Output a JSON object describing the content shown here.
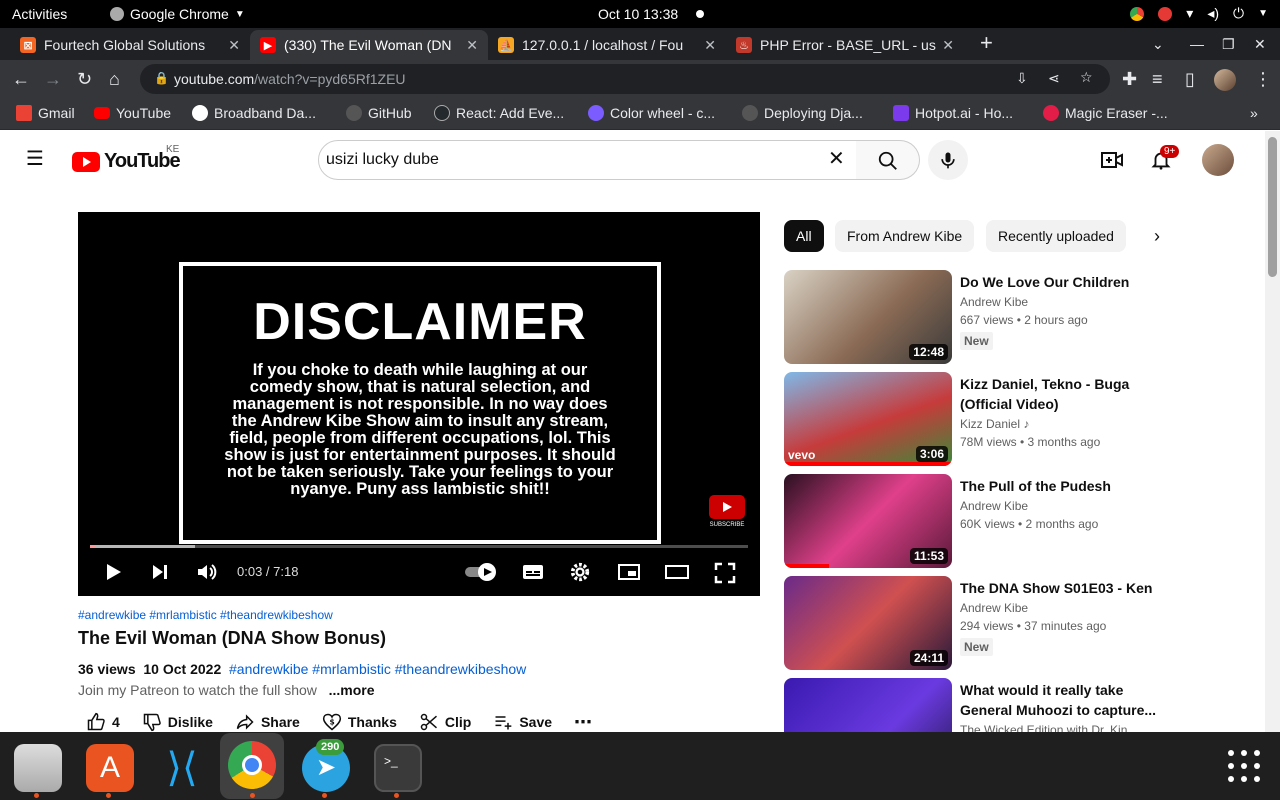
{
  "system": {
    "activities": "Activities",
    "app_name": "Google Chrome",
    "clock": "Oct 10  13:38"
  },
  "tabs": [
    {
      "title": "Fourtech Global Solutions",
      "fav_color": "#f26522"
    },
    {
      "title": "(330) The Evil Woman (DN",
      "fav_color": "#ff0000"
    },
    {
      "title": "127.0.0.1 / localhost / Fou",
      "fav_color": "#f5a623"
    },
    {
      "title": "PHP Error - BASE_URL - us",
      "fav_color": "#c0392b"
    }
  ],
  "omnibox": {
    "host": "youtube.com",
    "path": "/watch?v=pyd65Rf1ZEU"
  },
  "bookmarks": [
    {
      "label": "Gmail",
      "color": "#ea4335"
    },
    {
      "label": "YouTube",
      "color": "#ff0000"
    },
    {
      "label": "Broadband Da...",
      "color": "#ffffff"
    },
    {
      "label": "GitHub",
      "color": "#555555"
    },
    {
      "label": "React: Add Eve...",
      "color": "#24292e"
    },
    {
      "label": "Color wheel - c...",
      "color": "#7b5cff"
    },
    {
      "label": "Deploying Dja...",
      "color": "#555555"
    },
    {
      "label": "Hotpot.ai - Ho...",
      "color": "#7c3aed"
    },
    {
      "label": "Magic Eraser -...",
      "color": "#e11d48"
    }
  ],
  "youtube": {
    "logo_text": "YouTube",
    "country": "KE",
    "search_value": "usizi lucky dube",
    "notif_count": "9+"
  },
  "player": {
    "heading": "DISCLAIMER",
    "body": "If you choke to death while laughing at our comedy show, that is natural selection, and management is not responsible. In no way does the Andrew Kibe Show aim to insult any stream,  field, people from different occupations, lol. This show is just for entertainment purposes. It should not be taken seriously. Take your feelings to your nyanye. Puny ass lambistic shit!!",
    "subscribe": "SUBSCRIBE",
    "time": "0:03 / 7:18",
    "progress": 0.007,
    "buffered": 0.16
  },
  "video": {
    "tags": "#andrewkibe #mrlambistic #theandrewkibeshow",
    "title": "The Evil Woman (DNA Show Bonus)",
    "views": "36 views",
    "date": "10 Oct 2022",
    "meta_tags": "#andrewkibe #mrlambistic #theandrewkibeshow",
    "description": "Join my Patreon to watch the full show",
    "more": "...more",
    "likes": "4",
    "actions": [
      "Dislike",
      "Share",
      "Thanks",
      "Clip",
      "Save"
    ]
  },
  "chips": [
    "All",
    "From Andrew Kibe",
    "Recently uploaded"
  ],
  "recommendations": [
    {
      "title": "Do We Love Our Children",
      "channel": "Andrew Kibe",
      "views": "667 views • 2 hours ago",
      "badge": "New",
      "duration": "12:48",
      "watched": 0,
      "thumb": "linear-gradient(135deg,#d9d2c5,#8b6b55 55%,#3a3a3a)"
    },
    {
      "title": "Kizz Daniel, Tekno - Buga (Official Video)",
      "channel": "Kizz Daniel",
      "views": "78M views • 3 months ago",
      "badge": "",
      "duration": "3:06",
      "watched": 1,
      "thumb": "linear-gradient(160deg,#7fb8e8,#c63b3b 55%,#3a8a3a)"
    },
    {
      "title": "The Pull of the Pudesh",
      "channel": "Andrew Kibe",
      "views": "60K views • 2 months ago",
      "badge": "",
      "duration": "11:53",
      "watched": 0.27,
      "thumb": "linear-gradient(135deg,#2a1020,#e0408a 50%,#5a1a3a)"
    },
    {
      "title": "The DNA Show S01E03 - Ken",
      "channel": "Andrew Kibe",
      "views": "294 views • 37 minutes ago",
      "badge": "New",
      "duration": "24:11",
      "watched": 0,
      "thumb": "linear-gradient(135deg,#6a2a8a,#d05050 50%,#2a1a3a)"
    },
    {
      "title": "What would it really take General Muhoozi to capture...",
      "channel": "The Wicked Edition with Dr. Kin...",
      "views": "",
      "badge": "",
      "duration": "",
      "watched": 0,
      "thumb": "linear-gradient(135deg,#3a1ab0,#6a3ae0 60%,#2a1a5a)"
    }
  ],
  "dock": {
    "telegram_badge": "290"
  }
}
